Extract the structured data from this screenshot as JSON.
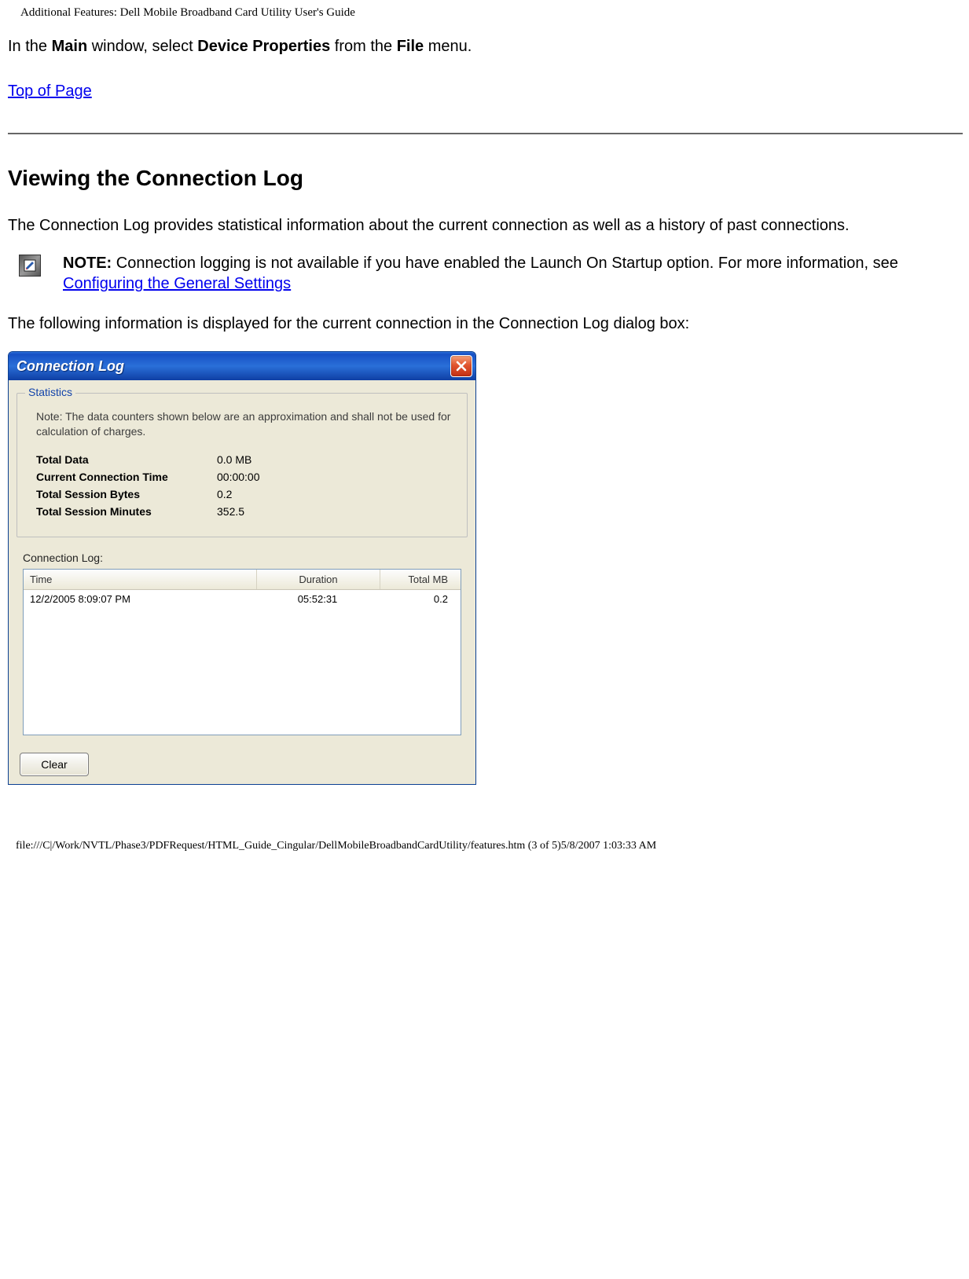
{
  "header_text": "Additional Features: Dell Mobile Broadband Card Utility User's Guide",
  "intro": {
    "prefix": "In the ",
    "bold1": "Main",
    "mid1": " window, select ",
    "bold2": "Device Properties",
    "mid2": " from the ",
    "bold3": "File",
    "suffix": " menu."
  },
  "top_link_label": "Top of Page",
  "section_title": "Viewing the Connection Log",
  "para2": "The Connection Log provides statistical information about the current connection as well as a history of past connections.",
  "note": {
    "bold": "NOTE:",
    "text_before_link": " Connection logging is not available if you have enabled the Launch On Startup option. For more information, see ",
    "link_label": "Configuring the General Settings"
  },
  "para3": "The following information is displayed for the current connection in the Connection Log dialog box:",
  "dialog": {
    "title": "Connection Log",
    "group_legend": "Statistics",
    "note_text": "Note: The data counters shown below are an approximation and shall not be used for calculation of charges.",
    "stats": {
      "total_data_label": "Total Data",
      "total_data_value": "0.0 MB",
      "conn_time_label": "Current Connection Time",
      "conn_time_value": "00:00:00",
      "sess_bytes_label": "Total Session Bytes",
      "sess_bytes_value": "0.2",
      "sess_min_label": "Total Session Minutes",
      "sess_min_value": "352.5"
    },
    "log_label": "Connection Log:",
    "columns": {
      "time": "Time",
      "duration": "Duration",
      "total_mb": "Total MB"
    },
    "row": {
      "time": "12/2/2005 8:09:07 PM",
      "duration": "05:52:31",
      "total_mb": "0.2"
    },
    "clear_button": "Clear"
  },
  "footer_text": "file:///C|/Work/NVTL/Phase3/PDFRequest/HTML_Guide_Cingular/DellMobileBroadbandCardUtility/features.htm (3 of 5)5/8/2007 1:03:33 AM"
}
